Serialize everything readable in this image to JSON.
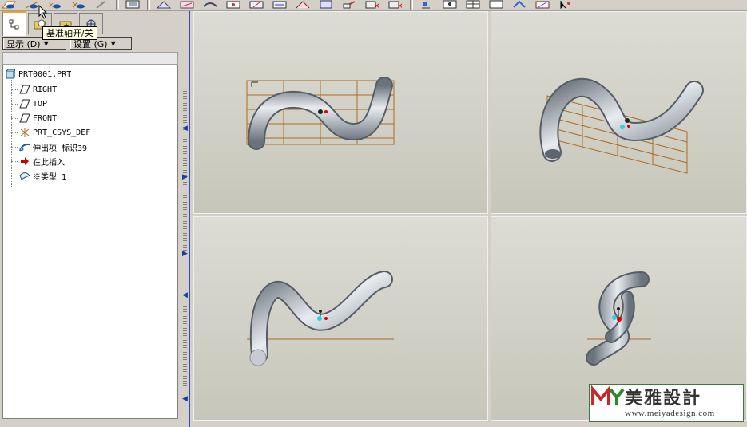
{
  "tooltip": {
    "text": "基准轴开/关"
  },
  "model_tree": {
    "display_button": "显示 (D)",
    "settings_button": "设置 (G)",
    "items": [
      {
        "label": "PRT0001.PRT",
        "icon": "part-icon"
      },
      {
        "label": "RIGHT",
        "icon": "datum-plane-icon"
      },
      {
        "label": "TOP",
        "icon": "datum-plane-icon"
      },
      {
        "label": "FRONT",
        "icon": "datum-plane-icon"
      },
      {
        "label": "PRT_CSYS_DEF",
        "icon": "coordinate-system-icon"
      },
      {
        "label": "伸出项 标识39",
        "icon": "sweep-protrusion-icon"
      },
      {
        "label": "在此插入",
        "icon": "insert-here-arrow-icon"
      },
      {
        "label": "※类型 1",
        "icon": "annotation-type-icon"
      }
    ]
  },
  "watermark": {
    "brand": "美雅設計",
    "url": "www.meiyadesign.com"
  },
  "colors": {
    "datum_grid": "#b06a20",
    "tube_light": "#e8ecf0",
    "tube_dark": "#6a727c",
    "splitter_arrow": "#1a3ca8",
    "tooltip_bg": "#ffffe1"
  }
}
